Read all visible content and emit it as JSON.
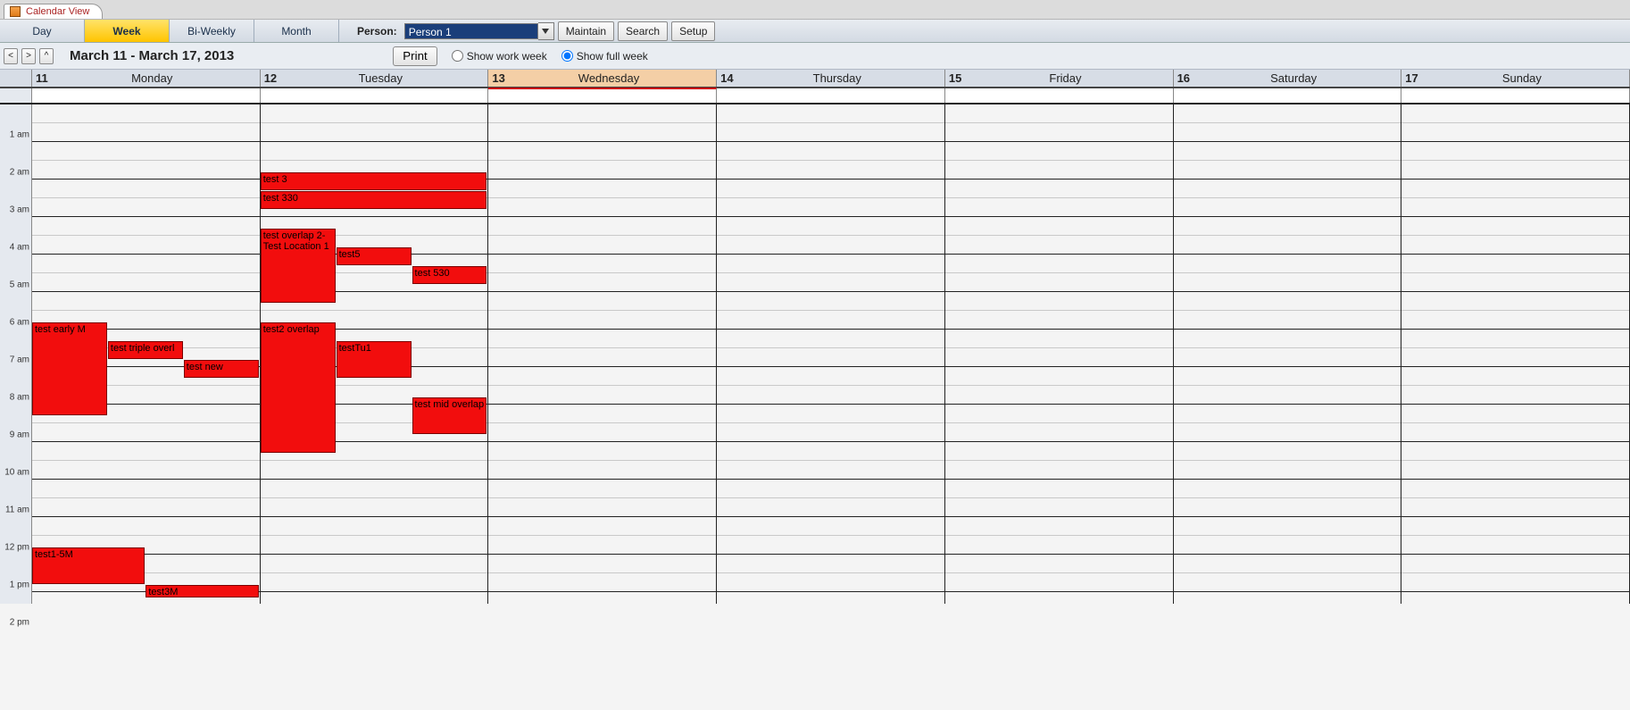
{
  "tab": {
    "title": "Calendar View"
  },
  "views": [
    {
      "label": "Day",
      "active": false
    },
    {
      "label": "Week",
      "active": true
    },
    {
      "label": "Bi-Weekly",
      "active": false
    },
    {
      "label": "Month",
      "active": false
    }
  ],
  "toolbar": {
    "person_label": "Person:",
    "person_value": "Person 1",
    "maintain_label": "Maintain",
    "search_label": "Search",
    "setup_label": "Setup"
  },
  "subbar": {
    "prev": "<",
    "next": ">",
    "up": "^",
    "date_range": "March 11 - March 17, 2013",
    "print_label": "Print",
    "work_week_label": "Show work week",
    "full_week_label": "Show full week",
    "week_mode": "full"
  },
  "days": [
    {
      "num": "11",
      "name": "Monday",
      "today": false
    },
    {
      "num": "12",
      "name": "Tuesday",
      "today": false
    },
    {
      "num": "13",
      "name": "Wednesday",
      "today": true
    },
    {
      "num": "14",
      "name": "Thursday",
      "today": false
    },
    {
      "num": "15",
      "name": "Friday",
      "today": false
    },
    {
      "num": "16",
      "name": "Saturday",
      "today": false
    },
    {
      "num": "17",
      "name": "Sunday",
      "today": false
    }
  ],
  "hours_start": 1,
  "hours_end": 14,
  "hour_height": 42,
  "hours": [
    {
      "label": "1  am"
    },
    {
      "label": "2  am"
    },
    {
      "label": "3  am"
    },
    {
      "label": "4  am"
    },
    {
      "label": "5  am"
    },
    {
      "label": "6  am"
    },
    {
      "label": "7  am"
    },
    {
      "label": "8  am"
    },
    {
      "label": "9  am"
    },
    {
      "label": "10 am"
    },
    {
      "label": "11 am"
    },
    {
      "label": "12 pm"
    },
    {
      "label": "1  pm"
    },
    {
      "label": "2  pm"
    }
  ],
  "events": [
    {
      "day": 0,
      "title": "test early M",
      "start": 7.0,
      "end": 9.5,
      "col": 0,
      "cols": 3
    },
    {
      "day": 0,
      "title": "test triple overl",
      "start": 7.5,
      "end": 8.0,
      "col": 1,
      "cols": 3
    },
    {
      "day": 0,
      "title": "test new",
      "start": 8.0,
      "end": 8.5,
      "col": 2,
      "cols": 3
    },
    {
      "day": 0,
      "title": "test1-5M",
      "start": 13.0,
      "end": 14.0,
      "col": 0,
      "cols": 2
    },
    {
      "day": 0,
      "title": "test3M",
      "start": 14.0,
      "end": 14.3,
      "col": 1,
      "cols": 2
    },
    {
      "day": 1,
      "title": "test 3",
      "start": 3.0,
      "end": 3.5,
      "col": 0,
      "cols": 1
    },
    {
      "day": 1,
      "title": "test 330",
      "start": 3.5,
      "end": 4.0,
      "col": 0,
      "cols": 1
    },
    {
      "day": 1,
      "title": "test overlap 2- Test Location 1",
      "start": 4.5,
      "end": 6.5,
      "col": 0,
      "cols": 3
    },
    {
      "day": 1,
      "title": "test5",
      "start": 5.0,
      "end": 5.5,
      "col": 1,
      "cols": 3
    },
    {
      "day": 1,
      "title": "test 530",
      "start": 5.5,
      "end": 6.0,
      "col": 2,
      "cols": 3
    },
    {
      "day": 1,
      "title": "test2 overlap",
      "start": 7.0,
      "end": 10.5,
      "col": 0,
      "cols": 3
    },
    {
      "day": 1,
      "title": "testTu1",
      "start": 7.5,
      "end": 8.5,
      "col": 1,
      "cols": 3
    },
    {
      "day": 1,
      "title": "test mid overlap",
      "start": 9.0,
      "end": 10.0,
      "col": 2,
      "cols": 3
    }
  ]
}
